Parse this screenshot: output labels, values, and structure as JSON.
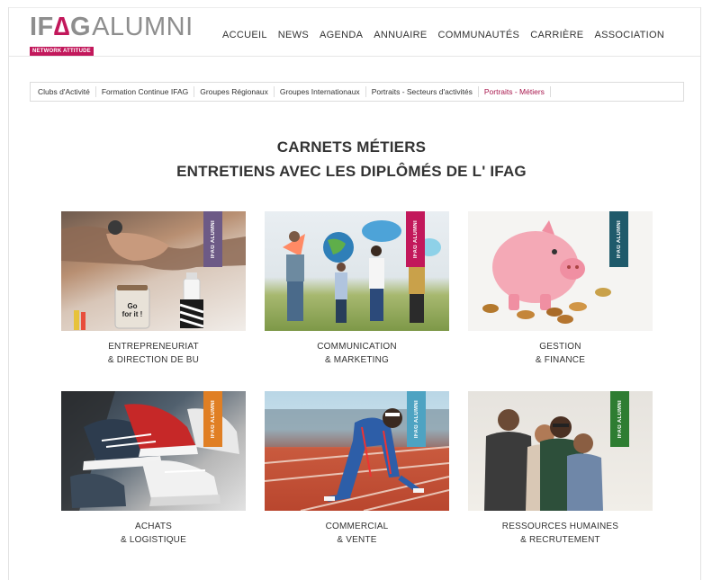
{
  "logo": {
    "brand": "IFAG",
    "brand_accent": "∆",
    "product": "ALUMNI",
    "tagline": "NETWORK ATTITUDE"
  },
  "main_nav": [
    "ACCUEIL",
    "NEWS",
    "AGENDA",
    "ANNUAIRE",
    "COMMUNAUTÉS",
    "CARRIÈRE",
    "ASSOCIATION"
  ],
  "sub_nav": [
    "Clubs d'Activité",
    "Formation Continue IFAG",
    "Groupes Régionaux",
    "Groupes Internationaux",
    "Portraits - Secteurs d'activités",
    "Portraits - Métiers"
  ],
  "sub_nav_active": "Portraits - Métiers",
  "heading": {
    "line1": "CARNETS MÉTIERS",
    "line2": "ENTRETIENS AVEC LES DIPLÔMÉS DE L' IFAG"
  },
  "cards": [
    {
      "line1": "ENTREPRENEURIAT",
      "line2": "& DIRECTION DE BU",
      "badge_color": "#6d5a86",
      "image": "handshake-photo",
      "jar_text_1": "Go",
      "jar_text_2": "for it !"
    },
    {
      "line1": "COMMUNICATION",
      "line2": "& MARKETING",
      "badge_color": "#c2185b",
      "image": "people-holding-icons-photo"
    },
    {
      "line1": "GESTION",
      "line2": "& FINANCE",
      "badge_color": "#1f5a6b",
      "image": "piggy-bank-photo"
    },
    {
      "line1": "ACHATS",
      "line2": "& LOGISTIQUE",
      "badge_color": "#e07f24",
      "image": "sneakers-basket-photo"
    },
    {
      "line1": "COMMERCIAL",
      "line2": "& VENTE",
      "badge_color": "#4ea3c2",
      "image": "sprinter-start-photo"
    },
    {
      "line1": "RESSOURCES HUMAINES",
      "line2": "& RECRUTEMENT",
      "badge_color": "#2e7d32",
      "image": "group-friends-photo"
    }
  ],
  "badge_text": "IFAG ALUMNI"
}
